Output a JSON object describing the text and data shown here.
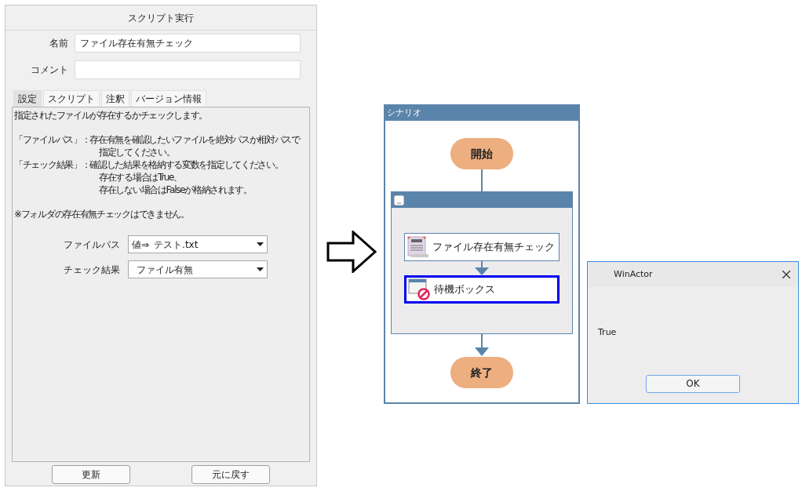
{
  "editor": {
    "title": "スクリプト実行",
    "fields": [
      {
        "label": "名前",
        "value": "ファイル存在有無チェック"
      },
      {
        "label": "コメント"
      }
    ],
    "tabs": [
      {
        "label": "設定",
        "selected": true
      },
      {
        "label": "スクリプト",
        "selected": false
      },
      {
        "label": "注釈",
        "selected": false
      },
      {
        "label": "バージョン情報",
        "selected": false
      }
    ],
    "description": [
      {
        "lines": [
          {
            "text": "指定されたファイルが存在するかチェックします。",
            "indent": false
          }
        ]
      },
      {
        "lines": [
          {
            "text": "「ファイルパス」：存在有無を確認したいファイルを絶対パスか相対パスで",
            "indent": false
          },
          {
            "text": "指定してください。",
            "indent": true
          },
          {
            "text": "「チェック結果」：確認した結果を格納する変数を指定してください。",
            "indent": false
          },
          {
            "text": "存在する場合はTrue、",
            "indent": true
          },
          {
            "text": "存在しない場合はFalseが格納されます。",
            "indent": true
          }
        ]
      },
      {
        "lines": [
          {
            "text": "※フォルダの存在有無チェックはできません。",
            "indent": false
          }
        ]
      }
    ],
    "settings": [
      {
        "label": "ファイルパス",
        "prefix": "値⇒",
        "value": "テスト.txt"
      },
      {
        "label": "チェック結果",
        "value": "ファイル有無"
      }
    ],
    "buttons": [
      "更新",
      "元に戻す"
    ]
  },
  "scenario": {
    "title": "シナリオ",
    "start": "開始",
    "end": "終了",
    "group": {
      "nodes": [
        {
          "kind": "script",
          "label": "ファイル存在有無チェック",
          "selected": false
        },
        {
          "kind": "wait",
          "label": "待機ボックス",
          "selected": true
        }
      ]
    }
  },
  "dialog": {
    "title": "WinActor",
    "message": "True",
    "button": "OK"
  }
}
